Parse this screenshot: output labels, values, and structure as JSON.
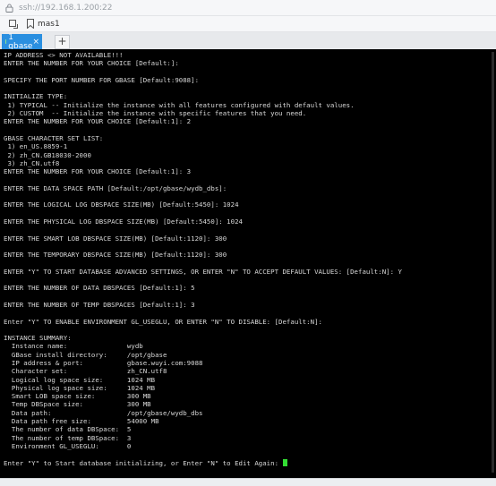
{
  "address_bar": {
    "url": "ssh://192.168.1.200:22"
  },
  "bookmark_bar": {
    "bookmark_label": "mas1"
  },
  "tabs": [
    {
      "label": "1 gbase",
      "close": "×"
    }
  ],
  "new_tab_label": "+",
  "terminal": {
    "lines": [
      "IP ADDRESS <> NOT AVAILABLE!!!",
      "ENTER THE NUMBER FOR YOUR CHOICE [Default:]:",
      "",
      "SPECIFY THE PORT NUMBER FOR GBASE [Default:9088]:",
      "",
      "INITIALIZE TYPE:",
      " 1) TYPICAL -- Initialize the instance with all features configured with default values.",
      " 2) CUSTOM  -- Initialize the instance with specific features that you need.",
      "ENTER THE NUMBER FOR YOUR CHOICE [Default:1]: 2",
      "",
      "GBASE CHARACTER SET LIST:",
      " 1) en_US.8859-1",
      " 2) zh_CN.GB18030-2000",
      " 3) zh_CN.utf8",
      "ENTER THE NUMBER FOR YOUR CHOICE [Default:1]: 3",
      "",
      "ENTER THE DATA SPACE PATH [Default:/opt/gbase/wydb_dbs]:",
      "",
      "ENTER THE LOGICAL LOG DBSPACE SIZE(MB) [Default:5450]: 1024",
      "",
      "ENTER THE PHYSICAL LOG DBSPACE SIZE(MB) [Default:5450]: 1024",
      "",
      "ENTER THE SMART LOB DBSPACE SIZE(MB) [Default:1120]: 300",
      "",
      "ENTER THE TEMPORARY DBSPACE SIZE(MB) [Default:1120]: 300",
      "",
      "ENTER \"Y\" TO START DATABASE ADVANCED SETTINGS, OR ENTER \"N\" TO ACCEPT DEFAULT VALUES: [Default:N]: Y",
      "",
      "ENTER THE NUMBER OF DATA DBSPACES [Default:1]: 5",
      "",
      "ENTER THE NUMBER OF TEMP DBSPACES [Default:1]: 3",
      "",
      "Enter \"Y\" TO ENABLE ENVIRONMENT GL_USEGLU, OR ENTER \"N\" TO DISABLE: [Default:N]:",
      "",
      "INSTANCE SUMMARY:",
      "  Instance name:               wydb",
      "  GBase install directory:     /opt/gbase",
      "  IP address & port:           gbase.wuyi.com:9088",
      "  Character set:               zh_CN.utf8",
      "  Logical log space size:      1024 MB",
      "  Physical log space size:     1024 MB",
      "  Smart LOB space size:        300 MB",
      "  Temp DBSpace size:           300 MB",
      "  Data path:                   /opt/gbase/wydb_dbs",
      "  Data path free size:         54000 MB",
      "  The number of data DBSpace:  5",
      "  The number of temp DBSpace:  3",
      "  Environment GL_USEGLU:       0",
      "",
      "Enter \"Y\" to Start database initializing, or Enter \"N\" to Edit Again: "
    ]
  },
  "status_bar": {
    "text": ""
  },
  "colors": {
    "tab_active": "#2a8fe0",
    "terminal_bg": "#000000",
    "terminal_text": "#d8d8d8",
    "cursor": "#33dd33"
  }
}
